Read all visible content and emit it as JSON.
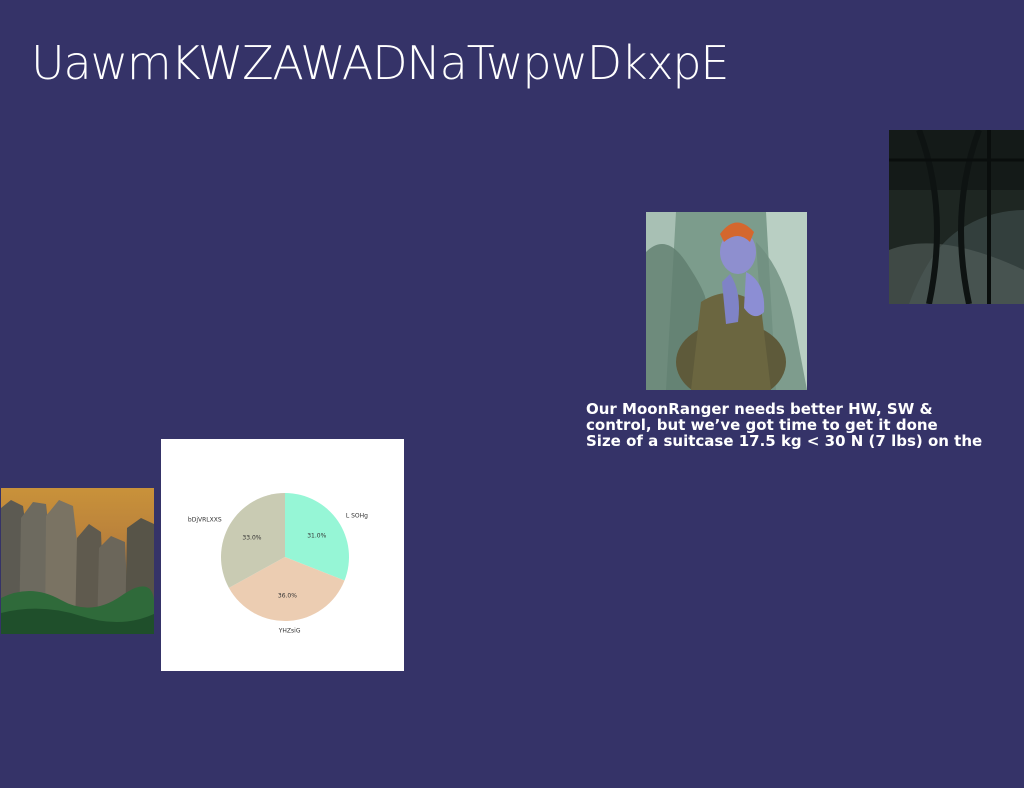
{
  "slide": {
    "title": "UawmKWZAWADNaTwpwDkxpE",
    "background_color": "#353368",
    "caption_lines": [
      "Our MoonRanger needs better HW, SW &",
      "control, but we’ve got time to get it done",
      "Size of a suitcase 17.5 kg < 30 N (7 lbs) on the"
    ]
  },
  "images": {
    "cliffs": {
      "icon": "rock-cliffs-photo"
    },
    "portrait": {
      "icon": "person-in-grass-photo"
    },
    "fence": {
      "icon": "dark-fence-photo"
    }
  },
  "chart_data": {
    "type": "pie",
    "title": "",
    "slices": [
      {
        "label": "L SOHg",
        "value": 31.0,
        "pct_label": "31.0%",
        "color": "#96f6d6"
      },
      {
        "label": "YHZsiG",
        "value": 36.0,
        "pct_label": "36.0%",
        "color": "#eccdb2"
      },
      {
        "label": "bDjVRLXXS",
        "value": 33.0,
        "pct_label": "33.0%",
        "color": "#c9cbb3"
      }
    ],
    "start_angle_deg": 90,
    "direction": "clockwise"
  }
}
